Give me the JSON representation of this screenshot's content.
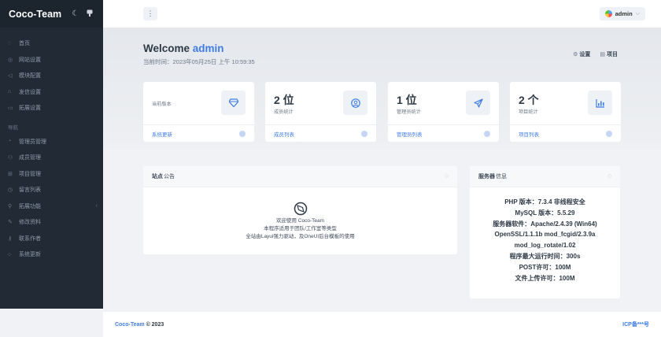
{
  "brand": {
    "name": "Coco-Team"
  },
  "sidebar": {
    "items_top": [
      {
        "label": "首页",
        "icon": "circle-icon"
      },
      {
        "label": "网站设置",
        "icon": "globe-icon"
      },
      {
        "label": "模块配置",
        "icon": "send-icon"
      },
      {
        "label": "发信设置",
        "icon": "mail-icon"
      },
      {
        "label": "拓展设置",
        "icon": "puzzle-icon"
      }
    ],
    "section_label": "导航",
    "items_nav": [
      {
        "label": "管理员管理",
        "icon": "user-icon"
      },
      {
        "label": "成员管理",
        "icon": "users-icon"
      },
      {
        "label": "项目管理",
        "icon": "grid-icon"
      },
      {
        "label": "留言列表",
        "icon": "chat-icon"
      },
      {
        "label": "拓展功能",
        "icon": "wrench-icon",
        "caret": "‹"
      },
      {
        "label": "修改资料",
        "icon": "edit-icon"
      },
      {
        "label": "联系作者",
        "icon": "key-icon"
      },
      {
        "label": "系统更新",
        "icon": "refresh-icon"
      }
    ]
  },
  "topbar": {
    "user": "admin"
  },
  "welcome": {
    "prefix": "Welcome",
    "name": "admin",
    "time": "当前时间：2023年05月25日 上午 10:59:35"
  },
  "quick": {
    "settings": "设置",
    "projects": "项目"
  },
  "stats": [
    {
      "value": "",
      "label": "当前版本",
      "footer": "系统更新",
      "icon": "diamond-icon"
    },
    {
      "value": "2 位",
      "label": "成员统计",
      "footer": "成员列表",
      "icon": "user-circle-icon"
    },
    {
      "value": "1 位",
      "label": "管理员统计",
      "footer": "管理员列表",
      "icon": "paper-plane-icon"
    },
    {
      "value": "2 个",
      "label": "项目统计",
      "footer": "项目列表",
      "icon": "bar-chart-icon"
    }
  ],
  "notice": {
    "title_bold": "站点",
    "title_rest": "公告",
    "lines": [
      "欢迎使用 Coco-Team",
      "本程序适用于团队/工作室等类型",
      "全站由Layui强力驱动，及OneUI后台模板的使用"
    ]
  },
  "server": {
    "title_bold": "服务器",
    "title_rest": "信息",
    "lines": [
      "PHP 版本：7.3.4 非线程安全",
      "MySQL 版本：5.5.29",
      "服务器软件：Apache/2.4.39 (Win64)",
      "OpenSSL/1.1.1b mod_fcgid/2.3.9a",
      "mod_log_rotate/1.02",
      "程序最大运行时间：300s",
      "POST许可：100M",
      "文件上传许可：100M"
    ]
  },
  "footer": {
    "brand": "Coco-Team",
    "copy": "© 2023",
    "icp": "ICP备***号"
  }
}
